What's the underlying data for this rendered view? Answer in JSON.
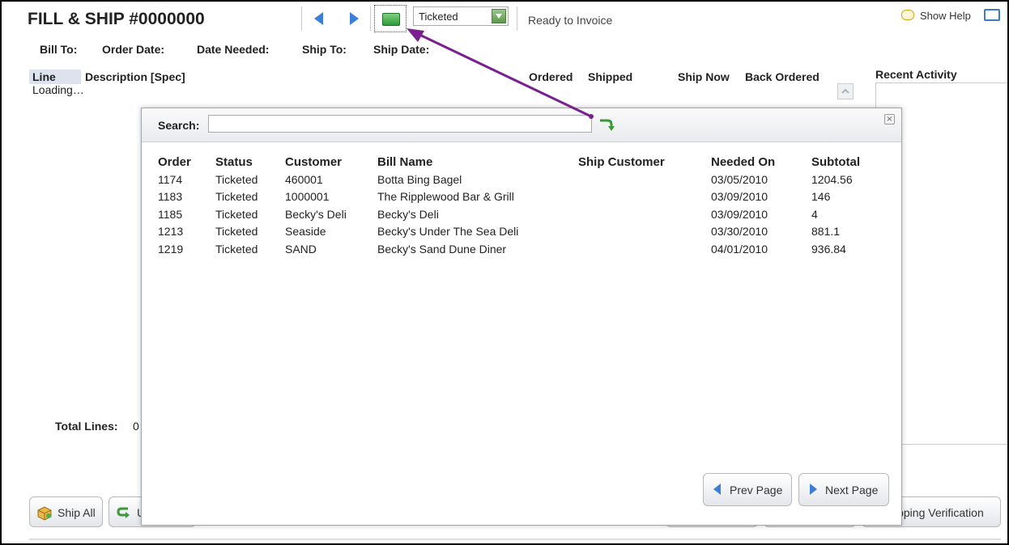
{
  "header": {
    "title": "FILL & SHIP #0000000",
    "status_select": "Ticketed",
    "status_text": "Ready to Invoice",
    "help_label": "Show Help"
  },
  "order_fields": {
    "bill_to": "Bill To:",
    "order_date": "Order Date:",
    "date_needed": "Date Needed:",
    "ship_to": "Ship To:",
    "ship_date": "Ship Date:"
  },
  "lines": {
    "columns": [
      "Line",
      "Description [Spec]",
      "Ordered",
      "Shipped",
      "Ship Now",
      "Back Ordered"
    ],
    "loading": "Loading…",
    "total_label": "Total Lines:",
    "total_value": "0"
  },
  "recent_activity": {
    "title": "Recent Activity"
  },
  "bottom_buttons": {
    "ship_all": "Ship All",
    "undo_partial": "U",
    "shipping_verification": "ipping Verification"
  },
  "modal": {
    "search_label": "Search:",
    "search_value": "",
    "columns": [
      "Order",
      "Status",
      "Customer",
      "Bill Name",
      "Ship Customer",
      "Needed On",
      "Subtotal"
    ],
    "rows": [
      [
        "1174",
        "Ticketed",
        "460001",
        "Botta Bing Bagel",
        "",
        "03/05/2010",
        "1204.56"
      ],
      [
        "1183",
        "Ticketed",
        "1000001",
        "The Ripplewood Bar & Grill",
        "",
        "03/09/2010",
        "146"
      ],
      [
        "1185",
        "Ticketed",
        "Becky's Deli",
        "Becky's Deli",
        "",
        "03/09/2010",
        "4"
      ],
      [
        "1213",
        "Ticketed",
        "Seaside",
        "Becky's Under The Sea Deli",
        "",
        "03/30/2010",
        "881.1"
      ],
      [
        "1219",
        "Ticketed",
        "SAND",
        "Becky's Sand Dune Diner",
        "",
        "04/01/2010",
        "936.84"
      ]
    ],
    "prev_page": "Prev Page",
    "next_page": "Next Page"
  },
  "colors": {
    "accent_blue": "#3d7fd8",
    "annotation_purple": "#7a1f8f",
    "go_green": "#3a9a3a"
  }
}
